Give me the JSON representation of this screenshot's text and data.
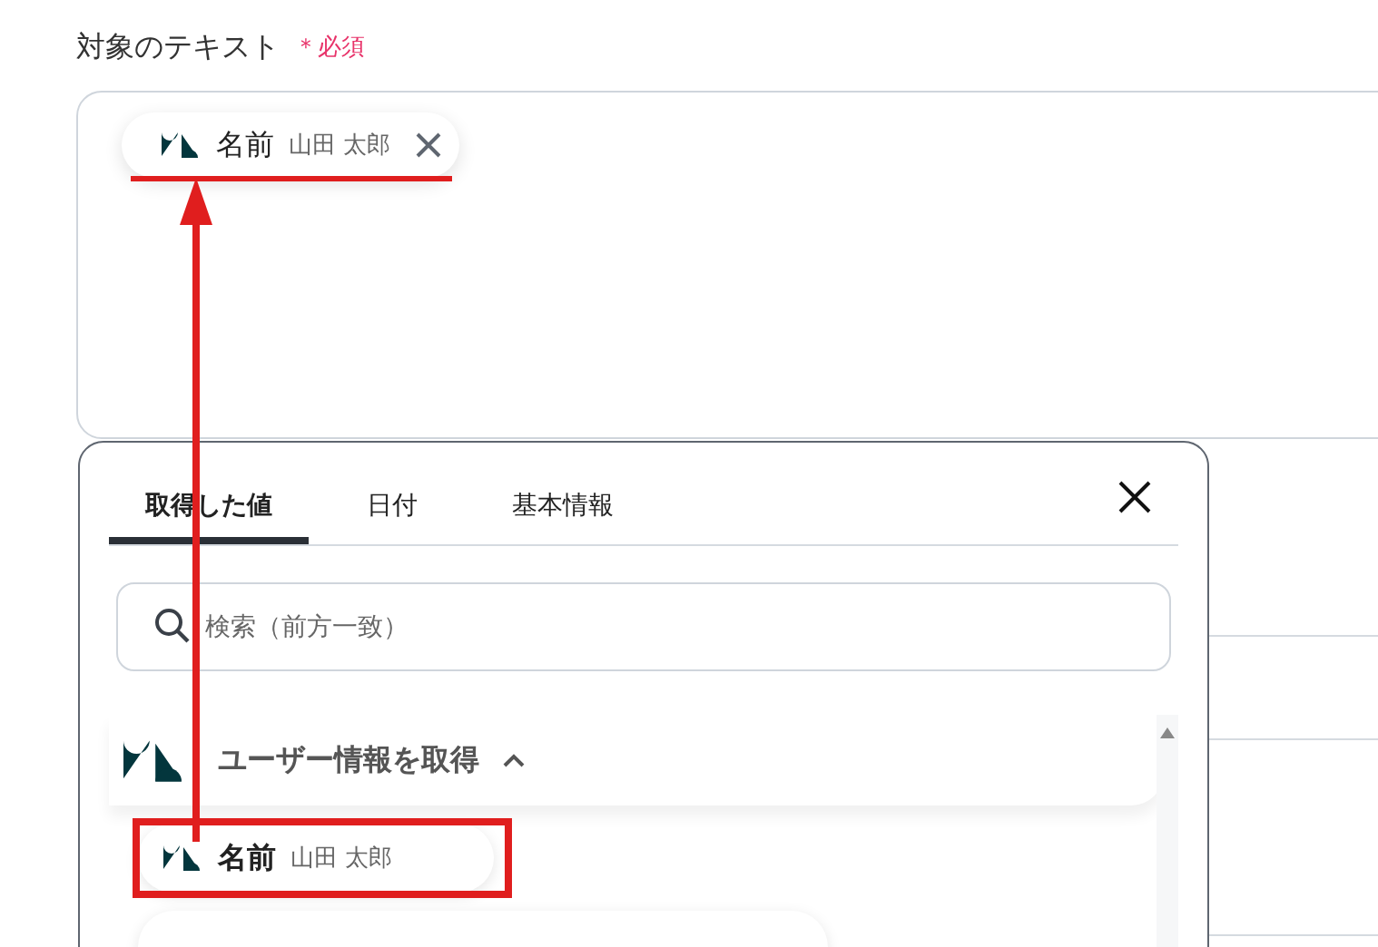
{
  "field": {
    "label": "対象のテキスト",
    "required": "＊必須",
    "tokens": [
      {
        "name": "名前",
        "value": "山田 太郎",
        "removable": true
      }
    ]
  },
  "picker": {
    "tabs": [
      {
        "label": "取得した値",
        "selected": true
      },
      {
        "label": "日付",
        "selected": false
      },
      {
        "label": "基本情報",
        "selected": false
      }
    ],
    "search": {
      "placeholder": "検索（前方一致）"
    },
    "groups": [
      {
        "title": "ユーザー情報を取得",
        "expanded": true,
        "items": [
          {
            "name": "名前",
            "value": "山田 太郎",
            "highlighted": true
          }
        ]
      }
    ]
  }
}
